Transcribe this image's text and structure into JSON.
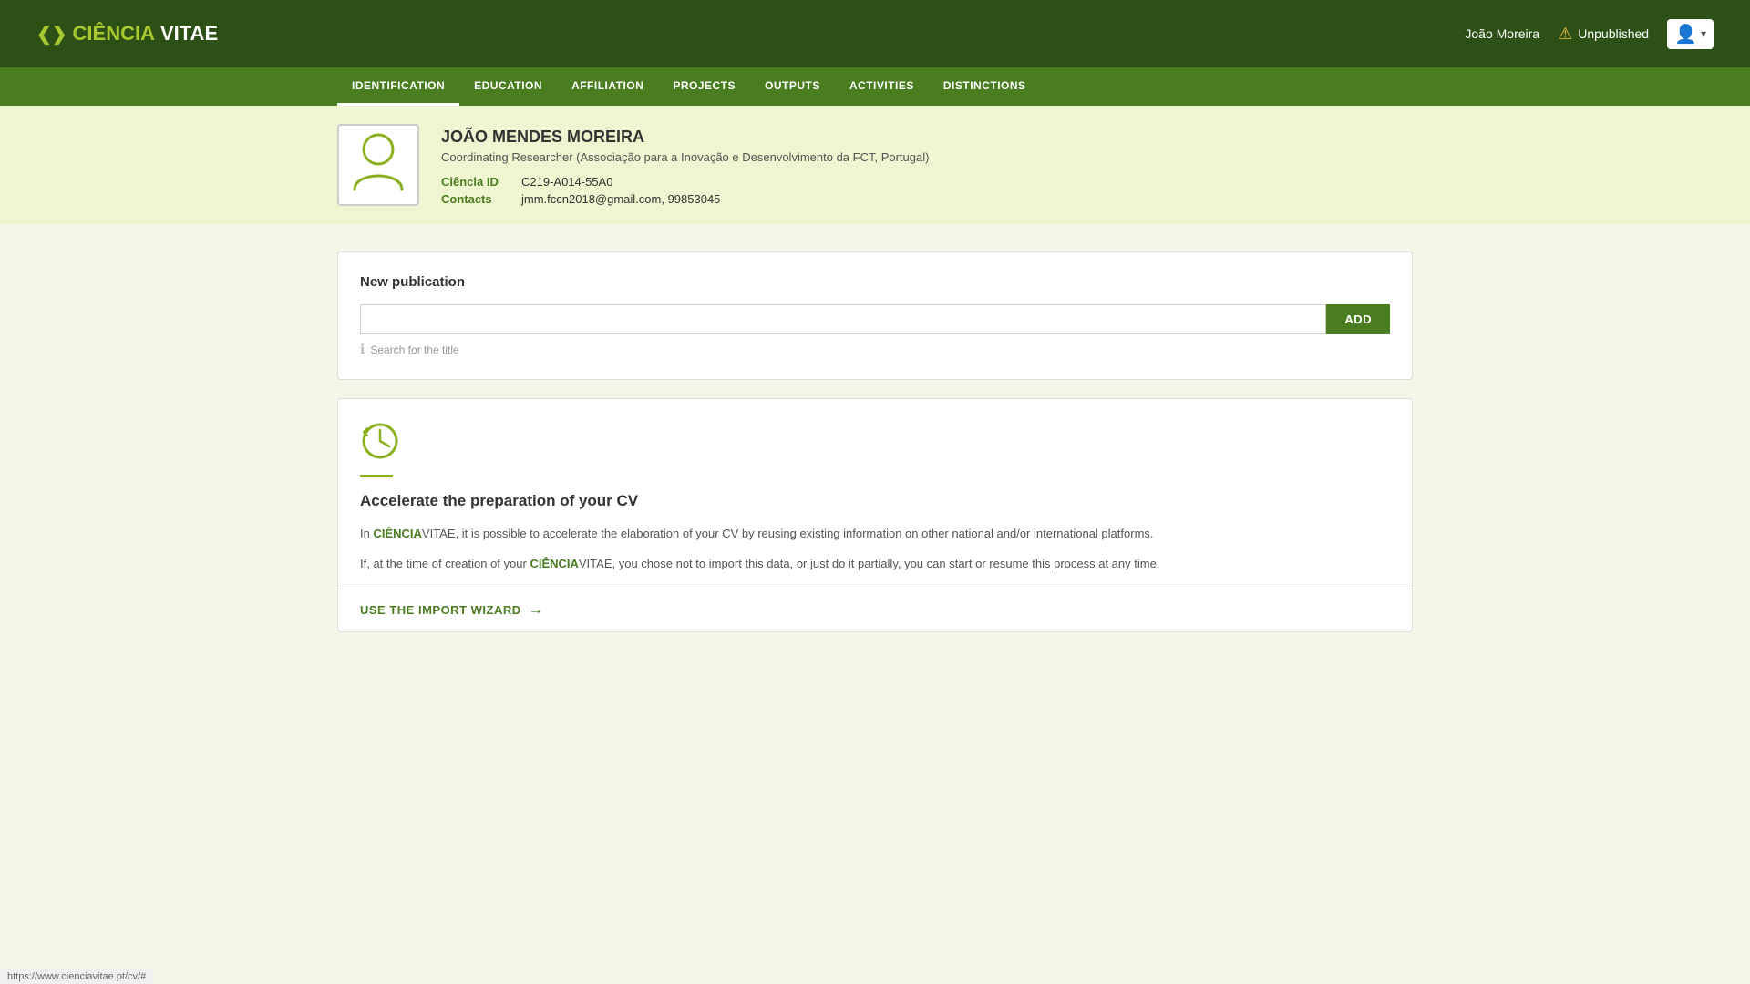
{
  "header": {
    "logo_ciencia": "CIÊNCIA",
    "logo_vitae": "VITAE",
    "user_name": "João Moreira",
    "unpublished_label": "Unpublished",
    "avatar_label": "👤"
  },
  "nav": {
    "items": [
      {
        "id": "identification",
        "label": "IDENTIFICATION",
        "active": true
      },
      {
        "id": "education",
        "label": "EDUCATION",
        "active": false
      },
      {
        "id": "affiliation",
        "label": "AFFILIATION",
        "active": false
      },
      {
        "id": "projects",
        "label": "PROJECTS",
        "active": false
      },
      {
        "id": "outputs",
        "label": "OUTPUTS",
        "active": false
      },
      {
        "id": "activities",
        "label": "ACTIVITIES",
        "active": false
      },
      {
        "id": "distinctions",
        "label": "DISTINCTIONS",
        "active": false
      }
    ]
  },
  "profile": {
    "name": "JOÃO MENDES MOREIRA",
    "role": "Coordinating Researcher (Associação para a Inovação e Desenvolvimento da FCT, Portugal)",
    "ciencia_id_label": "Ciência ID",
    "ciencia_id_value": "C219-A014-55A0",
    "contacts_label": "Contacts",
    "contacts_value": "jmm.fccn2018@gmail.com, 99853045"
  },
  "publication": {
    "title": "New publication",
    "input_placeholder": "",
    "add_button_label": "ADD",
    "search_hint": "Search for the title"
  },
  "accelerate": {
    "title": "Accelerate the preparation of your CV",
    "paragraph1_pre": "In ",
    "brand1": "CIÊNCIA",
    "paragraph1_mid": "VITAE, it is possible to accelerate the elaboration of your CV by reusing existing information on other national and/or international platforms.",
    "paragraph2_pre": "If, at the time of creation of your ",
    "brand2": "CIÊNCIA",
    "paragraph2_mid": "VITAE, you chose not to import this data, or just do it partially, you can start or resume this process at any time.",
    "import_link_label": "USE THE IMPORT WIZARD"
  },
  "status_bar": {
    "url": "https://www.cienciavitae.pt/cv/#"
  }
}
